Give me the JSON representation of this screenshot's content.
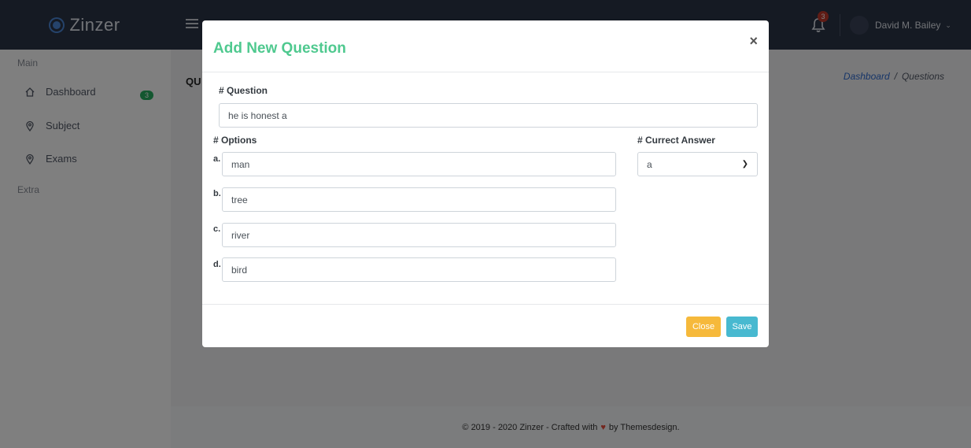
{
  "brand": {
    "name": "Zinzer"
  },
  "topbar": {
    "notification_count": "3",
    "user_name": "David M. Bailey"
  },
  "sidebar": {
    "main_heading": "Main",
    "extra_heading": "Extra",
    "items": [
      {
        "label": "Dashboard",
        "icon": "home-icon",
        "badge": "3"
      },
      {
        "label": "Subject",
        "icon": "map-pin-icon"
      },
      {
        "label": "Exams",
        "icon": "map-pin-icon"
      }
    ]
  },
  "page": {
    "title": "QU",
    "breadcrumb": {
      "link": "Dashboard",
      "separator": "/",
      "current": "Questions"
    }
  },
  "footer": {
    "text_before": "© 2019 - 2020 Zinzer - Crafted with",
    "text_after": "by Themesdesign."
  },
  "modal": {
    "title": "Add New Question",
    "close_symbol": "×",
    "question_label": "# Question",
    "question_value": "he is honest a",
    "options_label": "# Options",
    "correct_answer_label": "# Currect Answer",
    "correct_answer_value": "a",
    "options": [
      {
        "letter": "a.",
        "value": "man"
      },
      {
        "letter": "b.",
        "value": "tree"
      },
      {
        "letter": "c.",
        "value": "river"
      },
      {
        "letter": "d.",
        "value": "bird"
      }
    ],
    "close_button": "Close",
    "save_button": "Save"
  },
  "colors": {
    "topbar": "#2b3446",
    "title_green": "#4fc98f",
    "close_button": "#f6b93b",
    "save_button": "#48b9d0",
    "badge_green": "#27ae60",
    "notification_red": "#c0392b"
  }
}
